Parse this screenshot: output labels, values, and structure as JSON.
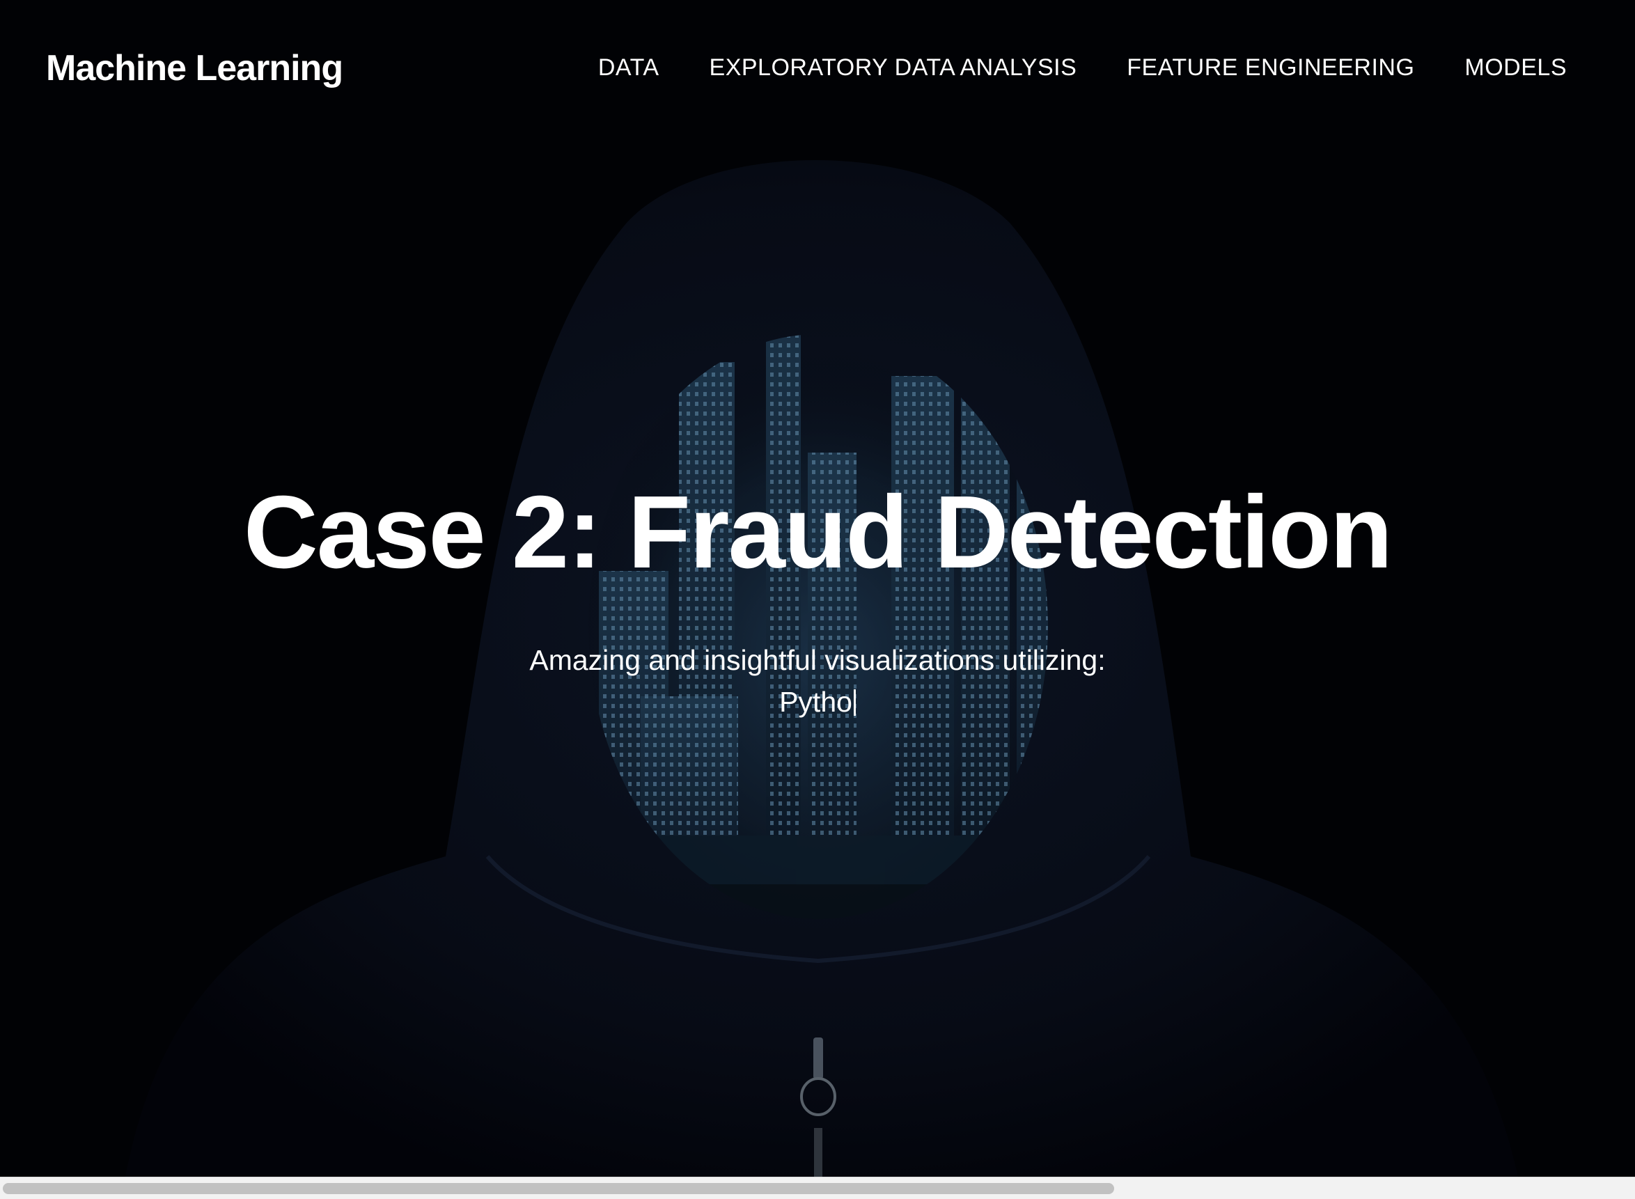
{
  "navbar": {
    "brand": "Machine Learning",
    "links": [
      {
        "label": "DATA"
      },
      {
        "label": "EXPLORATORY DATA ANALYSIS"
      },
      {
        "label": "FEATURE ENGINEERING"
      },
      {
        "label": "MODELS"
      }
    ]
  },
  "hero": {
    "title": "Case 2: Fraud Detection",
    "subtitle": "Amazing and insightful visualizations utilizing:",
    "typed_text": "Pytho"
  },
  "colors": {
    "text": "#ffffff",
    "background": "#010205",
    "city_glow": "#3a6f92"
  },
  "background_image": "hooded-figure-with-city-skyline",
  "scrollbar": {
    "orientation": "horizontal",
    "scroll_fraction_visible": 0.68
  }
}
